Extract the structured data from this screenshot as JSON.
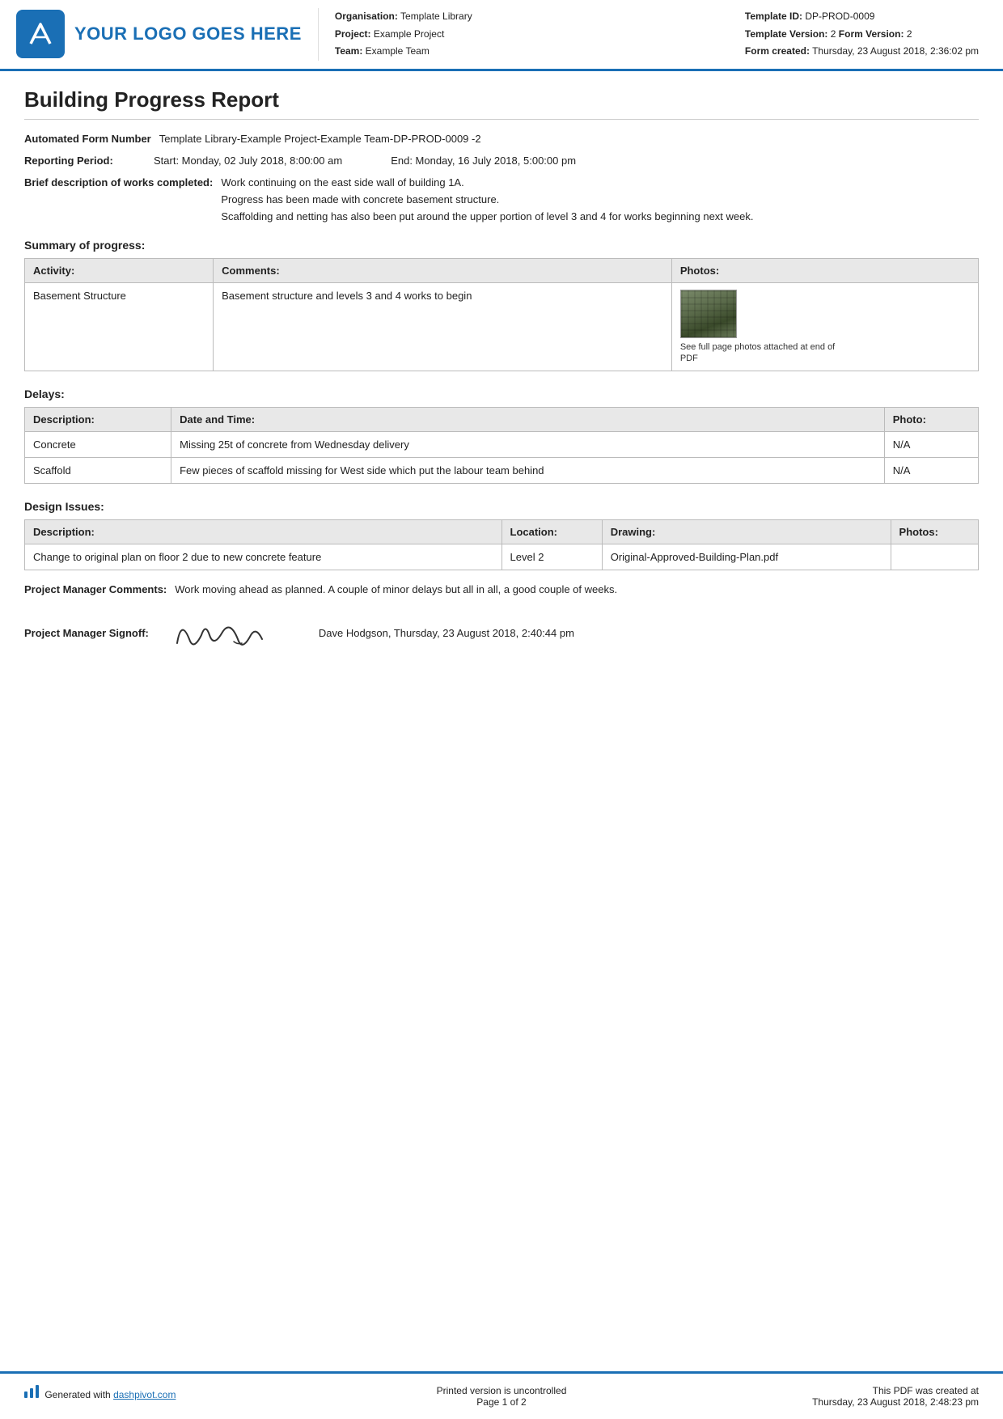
{
  "header": {
    "logo_text": "YOUR LOGO GOES HERE",
    "org_label": "Organisation:",
    "org_value": "Template Library",
    "project_label": "Project:",
    "project_value": "Example Project",
    "team_label": "Team:",
    "team_value": "Example Team",
    "template_id_label": "Template ID:",
    "template_id_value": "DP-PROD-0009",
    "template_version_label": "Template Version:",
    "template_version_value": "2",
    "form_version_label": "Form Version:",
    "form_version_value": "2",
    "form_created_label": "Form created:",
    "form_created_value": "Thursday, 23 August 2018, 2:36:02 pm"
  },
  "report": {
    "title": "Building Progress Report",
    "automated_form_number_label": "Automated Form Number",
    "automated_form_number_value": "Template Library-Example Project-Example Team-DP-PROD-0009   -2",
    "reporting_period_label": "Reporting Period:",
    "reporting_period_start": "Start: Monday, 02 July 2018, 8:00:00 am",
    "reporting_period_end": "End: Monday, 16 July 2018, 5:00:00 pm",
    "brief_desc_label": "Brief description of works completed:",
    "brief_desc_lines": [
      "Work continuing on the east side wall of building 1A.",
      "Progress has been made with concrete basement structure.",
      "Scaffolding and netting has also been put around the upper portion of level 3 and 4 for works beginning next week."
    ]
  },
  "summary_section": {
    "title": "Summary of progress:",
    "table_headers": [
      "Activity:",
      "Comments:",
      "Photos:"
    ],
    "rows": [
      {
        "activity": "Basement Structure",
        "comments": "Basement structure and levels 3 and 4 works to begin",
        "has_photo": true,
        "photo_caption": "See full page photos attached at end of PDF"
      }
    ]
  },
  "delays_section": {
    "title": "Delays:",
    "table_headers": [
      "Description:",
      "Date and Time:",
      "Photo:"
    ],
    "rows": [
      {
        "description": "Concrete",
        "date_time": "Missing 25t of concrete from Wednesday delivery",
        "photo": "N/A"
      },
      {
        "description": "Scaffold",
        "date_time": "Few pieces of scaffold missing for West side which put the labour team behind",
        "photo": "N/A"
      }
    ]
  },
  "design_issues_section": {
    "title": "Design Issues:",
    "table_headers": [
      "Description:",
      "Location:",
      "Drawing:",
      "Photos:"
    ],
    "rows": [
      {
        "description": "Change to original plan on floor 2 due to new concrete feature",
        "location": "Level 2",
        "drawing": "Original-Approved-Building-Plan.pdf",
        "photos": ""
      }
    ]
  },
  "project_manager": {
    "comments_label": "Project Manager Comments:",
    "comments_value": "Work moving ahead as planned. A couple of minor delays but all in all, a good couple of weeks.",
    "signoff_label": "Project Manager Signoff:",
    "signoff_name": "Dave Hodgson, Thursday, 23 August 2018, 2:40:44 pm"
  },
  "footer": {
    "generated_text": "Generated with ",
    "dashpivot_link": "dashpivot.com",
    "printed_line1": "Printed version is uncontrolled",
    "printed_line2": "Page 1 of 2",
    "pdf_created_label": "This PDF was created at",
    "pdf_created_value": "Thursday, 23 August 2018, 2:48:23 pm"
  }
}
